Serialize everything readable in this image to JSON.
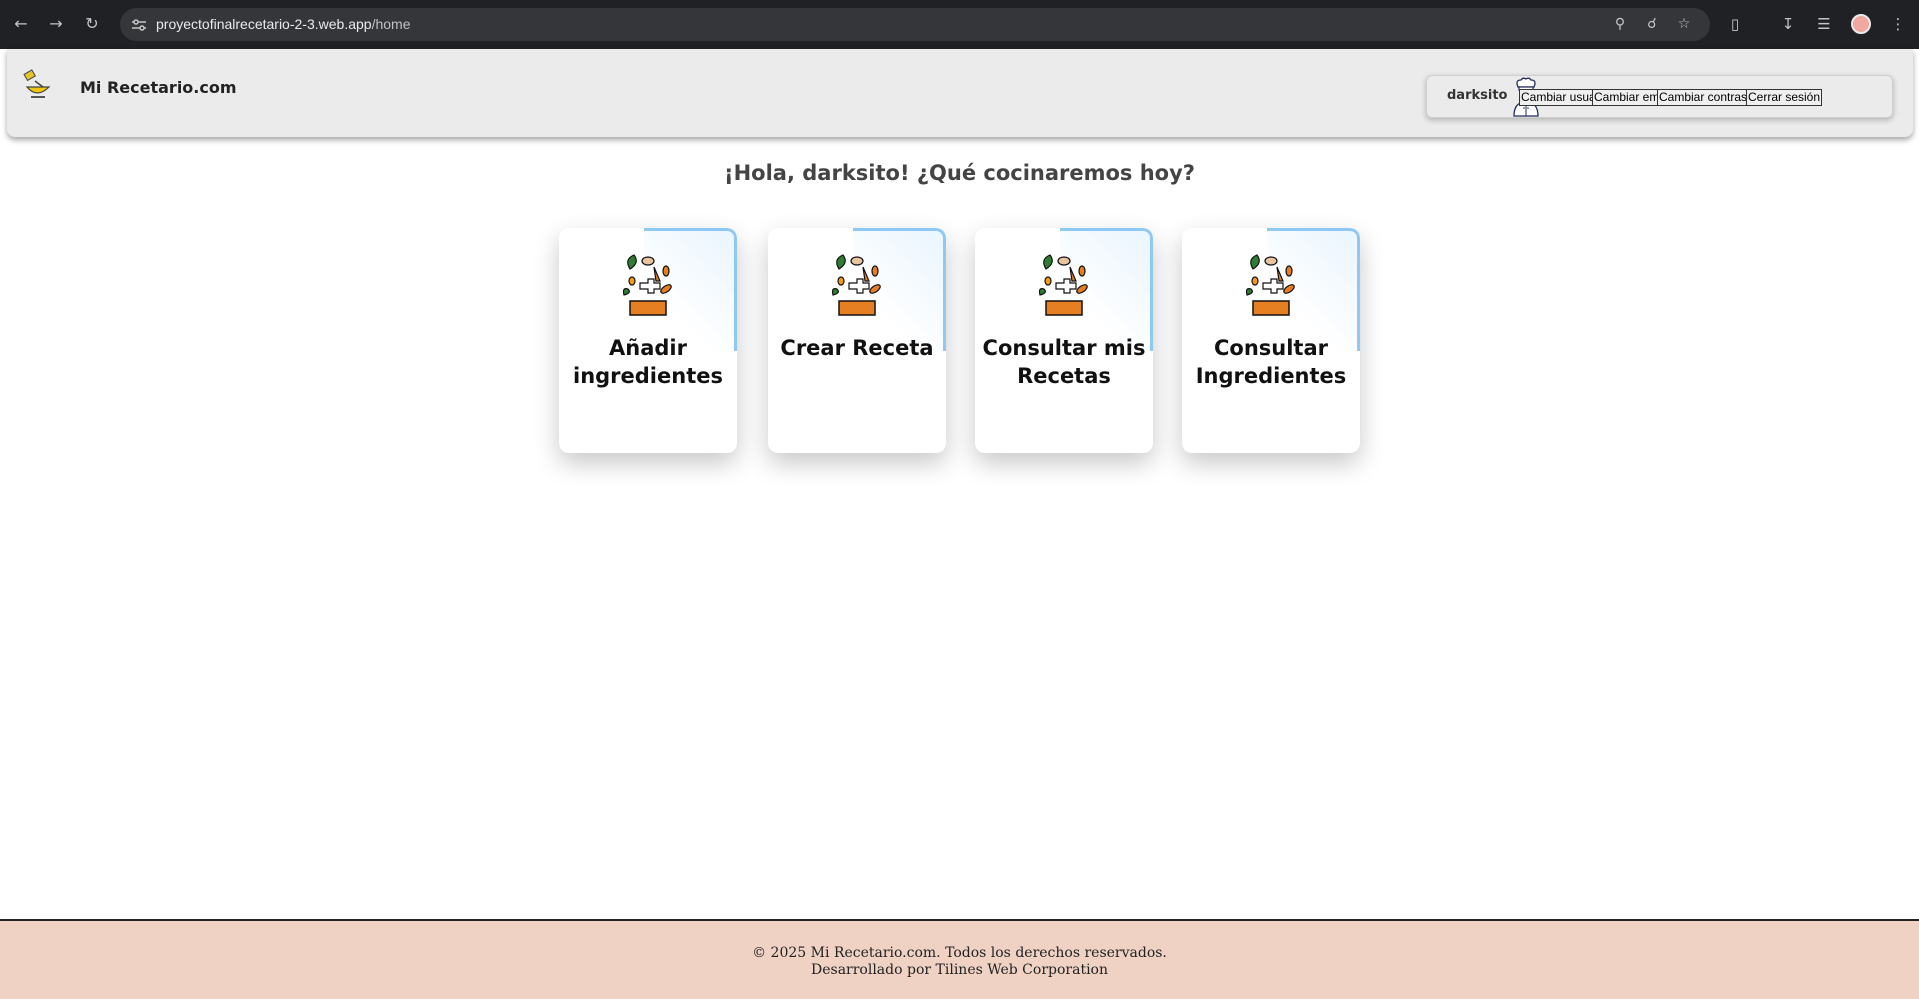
{
  "browser": {
    "url_host": "proyectofinalrecetario-2-3.web.app",
    "url_path": "/home"
  },
  "header": {
    "brand": "Mi Recetario.com",
    "username": "darksito",
    "buttons": [
      "Cambiar usuario",
      "Cambiar email",
      "Cambiar contraseña",
      "Cerrar sesión"
    ]
  },
  "main": {
    "greeting": "¡Hola, darksito! ¿Qué cocinaremos hoy?",
    "cards": [
      {
        "title": "Añadir ingredientes"
      },
      {
        "title": "Crear Receta"
      },
      {
        "title": "Consultar mis Recetas"
      },
      {
        "title": "Consultar Ingredientes"
      }
    ]
  },
  "footer": {
    "line1": "© 2025 Mi Recetario.com. Todos los derechos reservados.",
    "line2": "Desarrollado por Tilines Web Corporation"
  },
  "colors": {
    "footer_bg": "#f0d2c4",
    "card_accent": "#8ec9f5",
    "header_bg": "#ebebeb"
  }
}
